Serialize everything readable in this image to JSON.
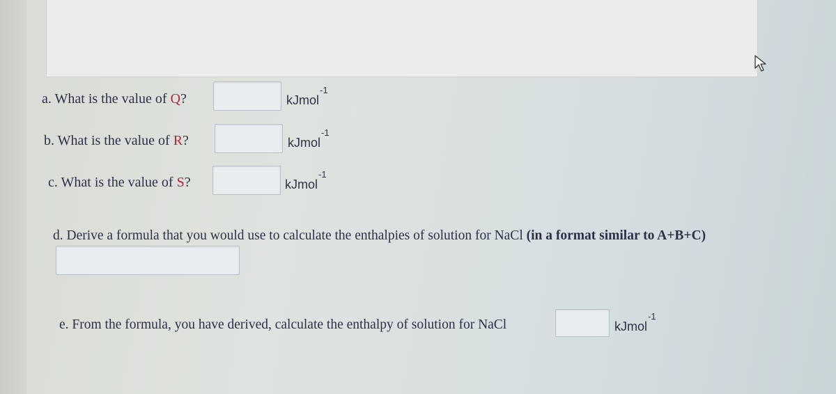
{
  "questions": {
    "a": {
      "prefix": "a. What is the value of ",
      "var": "Q",
      "suffix": "?"
    },
    "b": {
      "prefix": "b. What is the value of ",
      "var": "R",
      "suffix": "?"
    },
    "c": {
      "prefix": "c. What is the value of ",
      "var": "S",
      "suffix": "?"
    },
    "d": {
      "text": "d. Derive a formula that you would use to calculate the enthalpies of solution for NaCl ",
      "bold": "(in a format similar to A+B+C)"
    },
    "e": {
      "text": "e. From the formula, you have derived, calculate the enthalpy of solution for NaCl"
    }
  },
  "unit": {
    "base": "kJmol",
    "exponent": "-1"
  },
  "inputs": {
    "q_value": "",
    "r_value": "",
    "s_value": "",
    "formula": "",
    "enthalpy_value": ""
  },
  "icons": {
    "cursor": "cursor-arrow-icon"
  }
}
